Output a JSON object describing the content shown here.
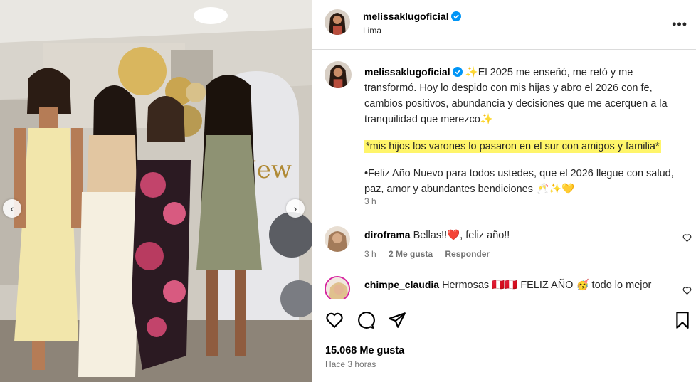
{
  "photo": {
    "nav_prev": "‹",
    "nav_next": "›"
  },
  "post": {
    "username": "melissaklugoficial",
    "location": "Lima",
    "more": "•••",
    "caption": {
      "line1_emoji": "✨",
      "text1": "El 2025 me enseñó, me retó y me transformó. Hoy lo despido con mis hijas y abro el 2026 con fe, cambios positivos, abundancia y decisiones que me acerquen a la tranquilidad que merezco",
      "text1_end_emoji": "✨",
      "highlight": "*mis hijos los varones lo pasaron en el sur con amigos y familia*",
      "text2": "•Feliz Año Nuevo para todos ustedes, que el 2026 llegue con salud, paz, amor y abundantes bendiciones",
      "text2_emojis": "🥂✨💛"
    },
    "caption_time": "3 h",
    "likes": "15.068 Me gusta",
    "posted": "Hace 3 horas"
  },
  "comments": [
    {
      "username": "diroframa",
      "text": "Bellas!!❤️, feliz año!!",
      "time": "3 h",
      "likes": "2 Me gusta",
      "reply": "Responder"
    },
    {
      "username": "chimpe_claudia",
      "text": "Hermosas 🇵🇪🇵🇪 FELIZ AÑO 🥳 todo lo mejor"
    }
  ],
  "colors": {
    "verified": "#0095f6",
    "highlight": "#fff56a",
    "muted": "#737373",
    "border": "#dbdbdb"
  }
}
